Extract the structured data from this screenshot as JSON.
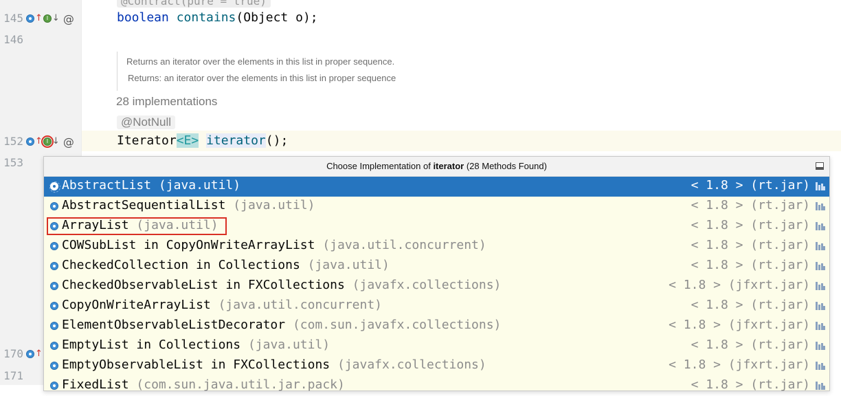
{
  "editor": {
    "top_hint": "@Contract(pure = true)",
    "line145": {
      "num": "145",
      "code_kw": "boolean",
      "code_method": "contains",
      "code_rest": "(Object o);"
    },
    "line146": {
      "num": "146"
    },
    "doc": {
      "line1": "Returns an iterator over the elements in this list in proper sequence.",
      "line2": "Returns: an iterator over the elements in this list in proper sequence"
    },
    "implementations_label": "28 implementations",
    "annotation": "@NotNull",
    "line152": {
      "num": "152",
      "type": "Iterator",
      "lt": "<",
      "generic": "E",
      "gt": ">",
      "method": "iterator",
      "rest": "();"
    },
    "line153": {
      "num": "153"
    },
    "line170": {
      "num": "170"
    },
    "line171": {
      "num": "171"
    },
    "gutter_at": "@"
  },
  "popup": {
    "title_prefix": "Choose Implementation of ",
    "title_method": "iterator",
    "title_suffix": " (28 Methods Found)",
    "items": [
      {
        "name": "AbstractList",
        "pkg": "(java.util)",
        "version": "< 1.8 > (rt.jar)",
        "selected": true
      },
      {
        "name": "AbstractSequentialList",
        "pkg": "(java.util)",
        "version": "< 1.8 > (rt.jar)"
      },
      {
        "name": "ArrayList",
        "pkg": "(java.util)",
        "version": "< 1.8 > (rt.jar)",
        "highlighted": true
      },
      {
        "name": "COWSubList in CopyOnWriteArrayList",
        "pkg": "(java.util.concurrent)",
        "version": "< 1.8 > (rt.jar)"
      },
      {
        "name": "CheckedCollection in Collections",
        "pkg": "(java.util)",
        "version": "< 1.8 > (rt.jar)"
      },
      {
        "name": "CheckedObservableList in FXCollections",
        "pkg": "(javafx.collections)",
        "version": "< 1.8 > (jfxrt.jar)"
      },
      {
        "name": "CopyOnWriteArrayList",
        "pkg": "(java.util.concurrent)",
        "version": "< 1.8 > (rt.jar)"
      },
      {
        "name": "ElementObservableListDecorator",
        "pkg": "(com.sun.javafx.collections)",
        "version": "< 1.8 > (jfxrt.jar)"
      },
      {
        "name": "EmptyList in Collections",
        "pkg": "(java.util)",
        "version": "< 1.8 > (rt.jar)"
      },
      {
        "name": "EmptyObservableList in FXCollections",
        "pkg": "(javafx.collections)",
        "version": "< 1.8 > (jfxrt.jar)"
      },
      {
        "name": "FixedList",
        "pkg": "(com.sun.java.util.jar.pack)",
        "version": "< 1.8 > (rt.jar)"
      }
    ]
  }
}
